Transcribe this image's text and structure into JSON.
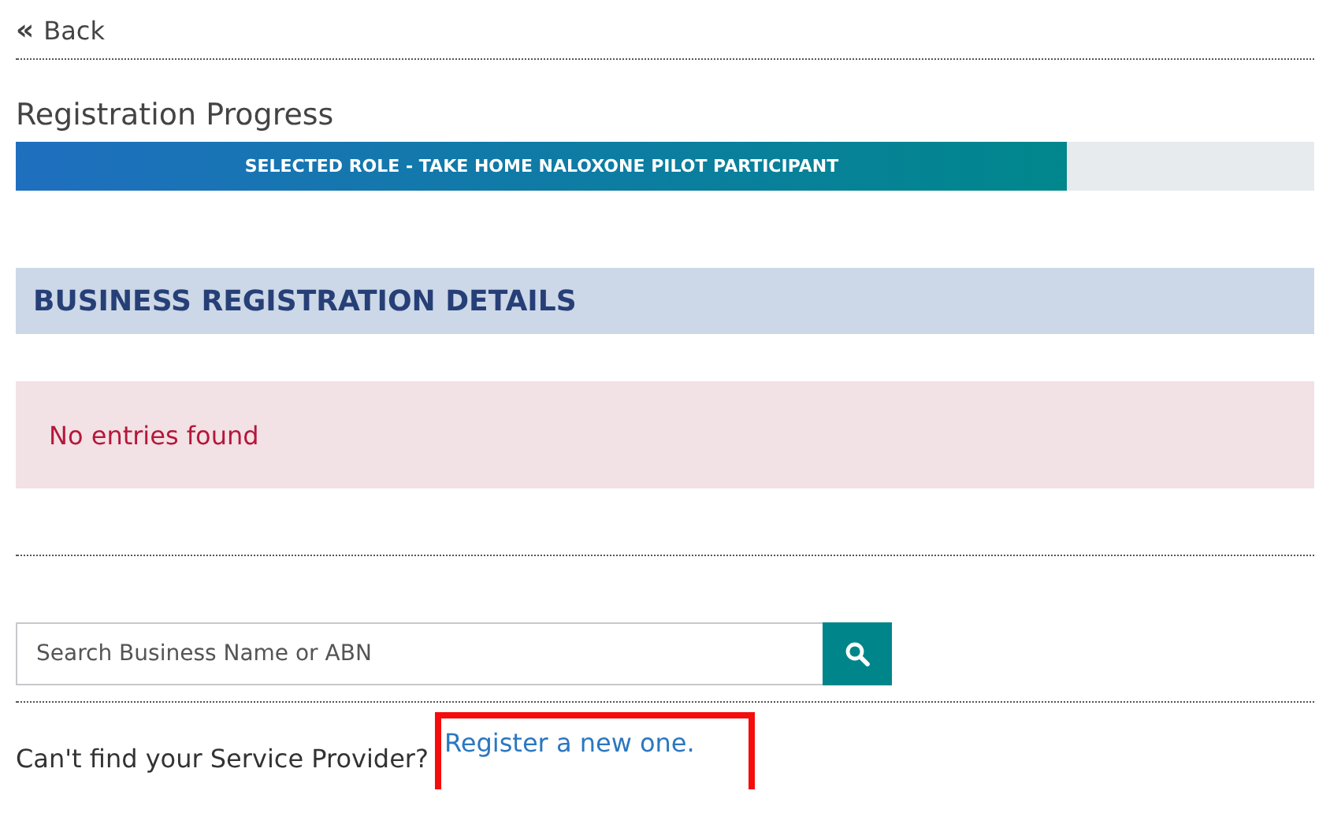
{
  "back_link": {
    "icon": "«",
    "label": "Back"
  },
  "progress": {
    "title": "Registration Progress",
    "label": "SELECTED ROLE - TAKE HOME NALOXONE PILOT PARTICIPANT",
    "level": 0.81
  },
  "section_heading": "BUSINESS REGISTRATION DETAILS",
  "alert": "No entries found",
  "search": {
    "placeholder": "Search Business Name or ABN"
  },
  "footer": {
    "question": "Can't find your Service Provider?",
    "link": "Register a new one.",
    "highlighted": true
  }
}
